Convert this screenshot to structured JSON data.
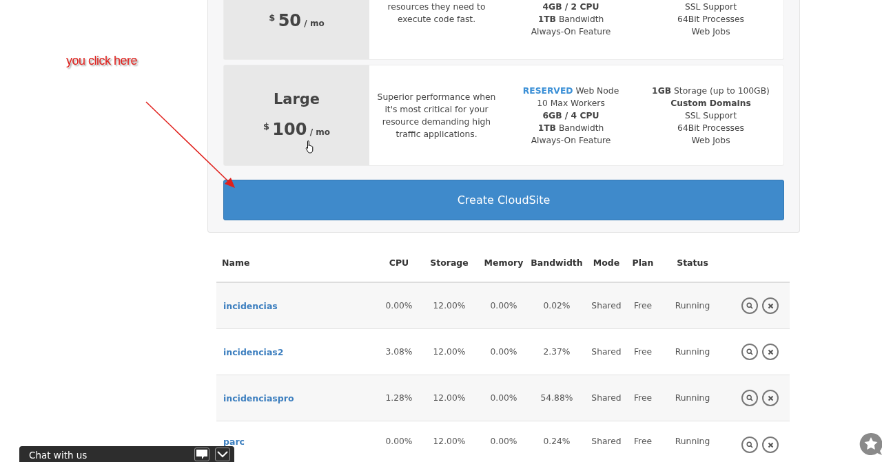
{
  "annotation": {
    "text": "you click here"
  },
  "plans": [
    {
      "currency": "$",
      "amount": "50",
      "period": "/ mo",
      "description": [
        "resources they need to",
        "execute code fast."
      ],
      "features": [
        "**4GB / 2 CPU**",
        "**1TB** Bandwidth",
        "Always-On Feature"
      ],
      "extras": [
        "SSL Support",
        "64Bit Processes",
        "Web Jobs"
      ]
    },
    {
      "name": "Large",
      "currency": "$",
      "amount": "100",
      "period": "/ mo",
      "description": [
        "Superior performance when",
        "it's most critical for your",
        "resource demanding high",
        "traffic applications."
      ],
      "features": [
        "**RESERVED** Web Node",
        "10 Max Workers",
        "**6GB / 4 CPU**",
        "**1TB** Bandwidth",
        "Always-On Feature"
      ],
      "extras": [
        "**1GB** Storage (up to 100GB)",
        "**Custom Domains**",
        "SSL Support",
        "64Bit Processes",
        "Web Jobs"
      ]
    }
  ],
  "create_button": {
    "label": "Create CloudSite"
  },
  "table": {
    "columns": [
      "Name",
      "CPU",
      "Storage",
      "Memory",
      "Bandwidth",
      "Mode",
      "Plan",
      "Status"
    ],
    "rows": [
      {
        "name": "incidencias",
        "cpu": "0.00%",
        "storage": "12.00%",
        "memory": "0.00%",
        "bandwidth": "0.02%",
        "mode": "Shared",
        "plan": "Free",
        "status": "Running"
      },
      {
        "name": "incidencias2",
        "cpu": "3.08%",
        "storage": "12.00%",
        "memory": "0.00%",
        "bandwidth": "2.37%",
        "mode": "Shared",
        "plan": "Free",
        "status": "Running"
      },
      {
        "name": "incidenciaspro",
        "cpu": "1.28%",
        "storage": "12.00%",
        "memory": "0.00%",
        "bandwidth": "54.88%",
        "mode": "Shared",
        "plan": "Free",
        "status": "Running"
      },
      {
        "name": "parc",
        "cpu": "0.00%",
        "storage": "12.00%",
        "memory": "0.00%",
        "bandwidth": "0.24%",
        "mode": "Shared",
        "plan": "Free",
        "status": "Running"
      }
    ]
  },
  "chat": {
    "label": "Chat with us"
  }
}
